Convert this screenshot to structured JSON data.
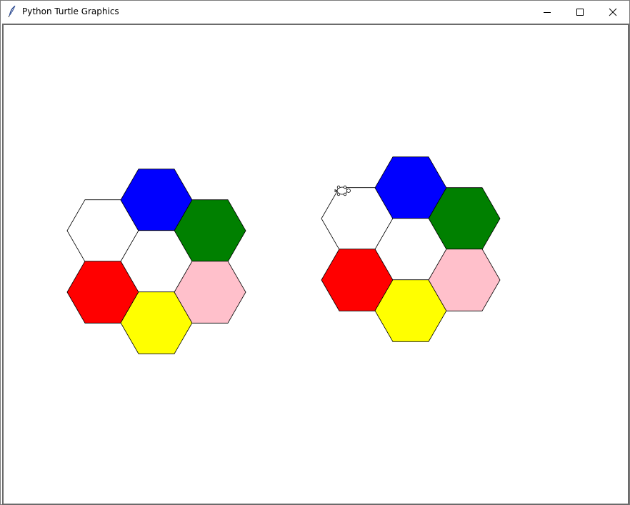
{
  "window": {
    "title": "Python Turtle Graphics",
    "buttons": {
      "minimize_icon": "minimize-icon",
      "maximize_icon": "maximize-icon",
      "close_icon": "close-icon"
    }
  },
  "canvas": {
    "background": "#ffffff",
    "outline_color": "#000000",
    "clusters": [
      {
        "name": "left-cluster",
        "hexagons": [
          {
            "color": "#ffffff"
          },
          {
            "color": "#0000ff"
          },
          {
            "color": "#008000"
          },
          {
            "color": "#ffffff"
          },
          {
            "color": "#ff0000"
          },
          {
            "color": "#ffff00"
          },
          {
            "color": "#ffc0cb"
          }
        ]
      },
      {
        "name": "right-cluster",
        "hexagons": [
          {
            "color": "#ffffff"
          },
          {
            "color": "#0000ff"
          },
          {
            "color": "#008000"
          },
          {
            "color": "#ffffff"
          },
          {
            "color": "#ff0000"
          },
          {
            "color": "#ffff00"
          },
          {
            "color": "#ffc0cb"
          }
        ]
      }
    ],
    "turtle": {
      "icon": "turtle-icon",
      "color": "#ffffff"
    }
  }
}
